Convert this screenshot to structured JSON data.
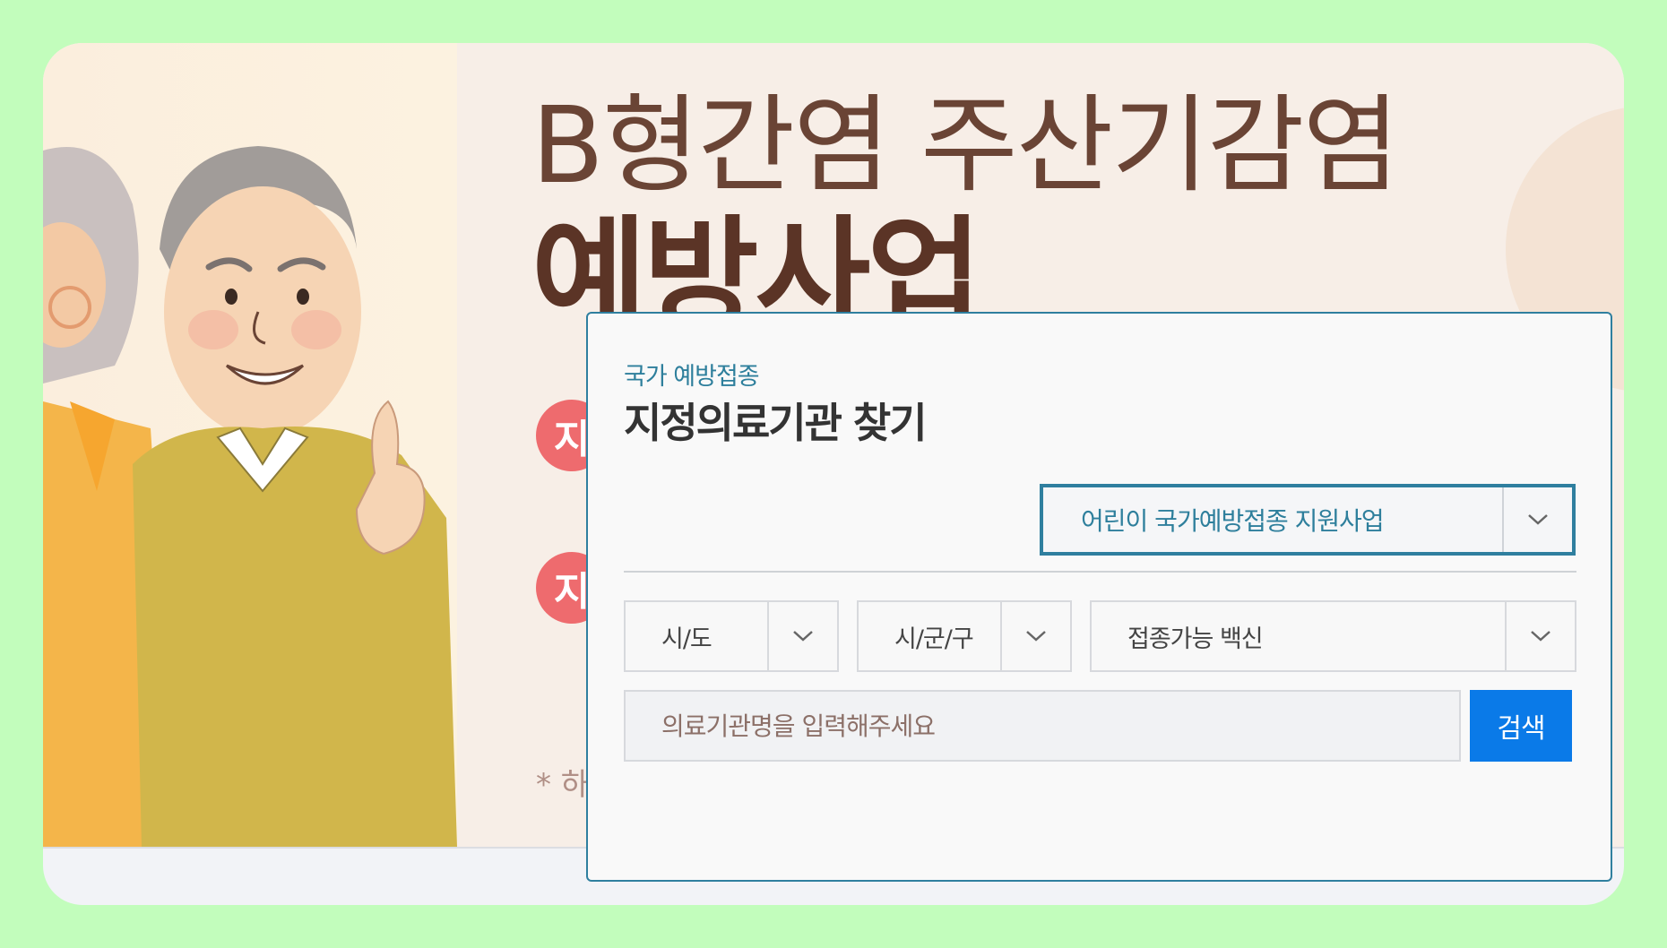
{
  "banner": {
    "title_line1": "B형간염 주산기감염",
    "title_line2": "예방사업",
    "pill_1": "지",
    "pill_2": "지",
    "footnote": "* 하"
  },
  "panel": {
    "eyebrow": "국가 예방접종",
    "title": "지정의료기관 찾기",
    "program_select": {
      "selected": "어린이 국가예방접종 지원사업"
    },
    "filters": [
      {
        "selected": "시/도"
      },
      {
        "selected": "시/군/구"
      },
      {
        "selected": "접종가능 백신"
      }
    ],
    "search": {
      "placeholder": "의료기관명을 입력해주세요",
      "value": "",
      "button_label": "검색"
    }
  },
  "colors": {
    "page_bg": "#c2fdbc",
    "accent_teal": "#2f7f9f",
    "search_blue": "#0a7ae8",
    "banner_brown": "#6a4435",
    "pill_red": "#ee6b6e"
  }
}
